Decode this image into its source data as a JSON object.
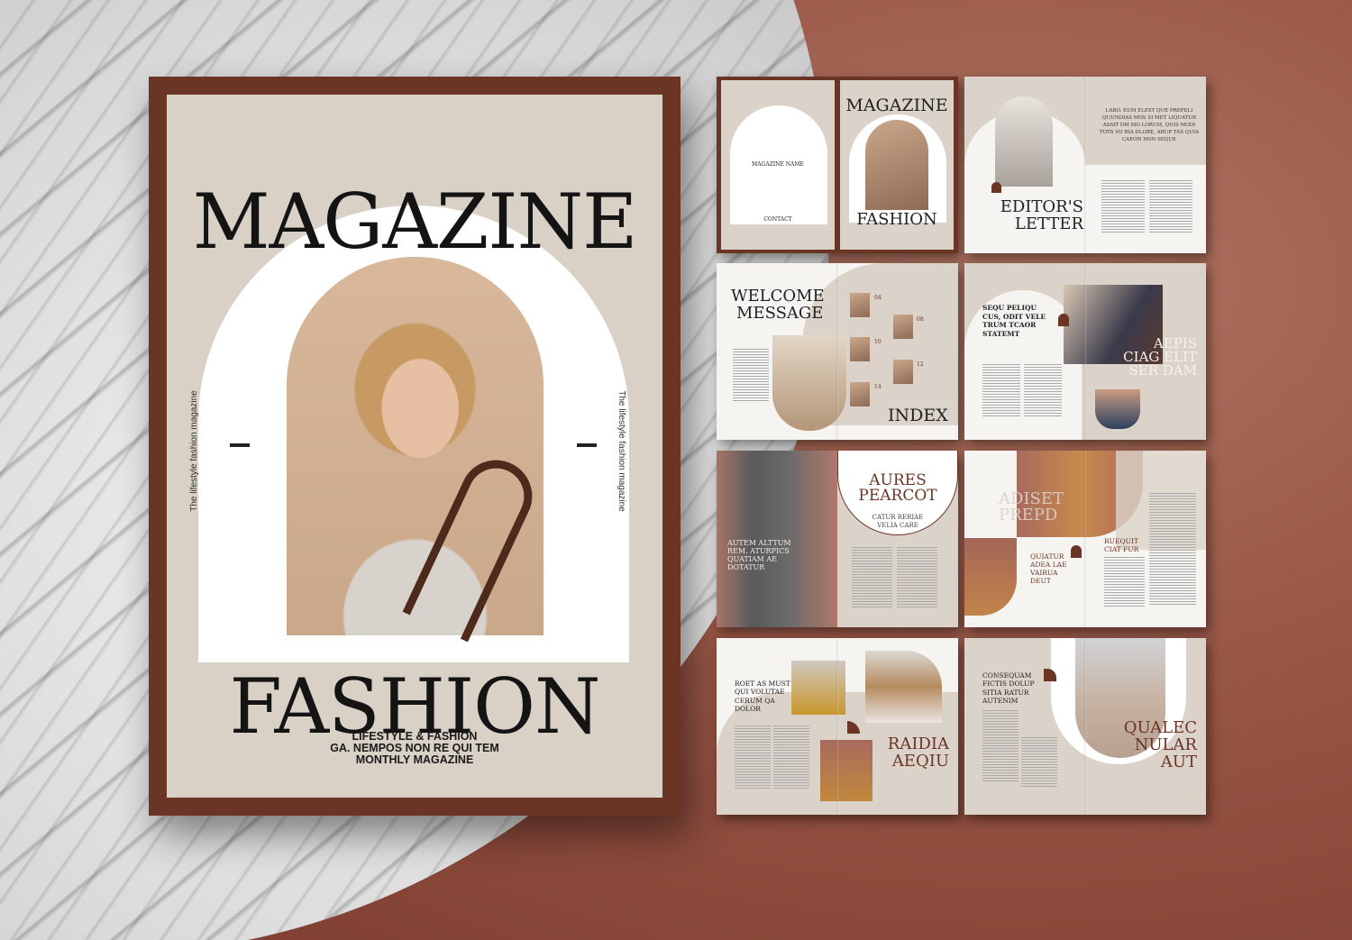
{
  "cover": {
    "title_top": "MAGAZINE",
    "title_bottom": "FASHION",
    "side_text": "The lifestyle fashion magazine",
    "subtitle": [
      "LIFESTYLE & FASHION",
      "GA. NEMPOS NON RE QUI TEM",
      "MONTHLY MAGAZINE"
    ]
  },
  "spreads": {
    "s1": {
      "back_title": "MAGAZINE NAME",
      "back_contact": "CONTACT",
      "front_top": "MAGAZINE",
      "front_bottom": "FASHION"
    },
    "s2": {
      "quote": "LABO. EUM ELEST QUE PREPELI QUUNDIAS MOS SI MET LIQUATUR ASSIT OM MO LORUM, QUIS MODI TOTA VO RIA DLORE, ARUP TAS QUIA CAEON NON SEQUE",
      "title": [
        "EDITOR'S",
        "LETTER"
      ]
    },
    "s3": {
      "title": [
        "WELCOME",
        "MESSAGE"
      ],
      "index_title": "INDEX",
      "index_numbers": [
        "04",
        "08",
        "10",
        "12",
        "14"
      ]
    },
    "s4": {
      "heading": [
        "SEQU PELIQU",
        "CUS, ODIT VELE",
        "TRUM TCAOR",
        "STATEMT"
      ],
      "overlay": [
        "AEPIS",
        "CIAG ELIT",
        "SER DAM"
      ]
    },
    "s5": {
      "overlay": [
        "AUTEM ALTTUM",
        "REM. ATURPICS",
        "QUATIAM AE",
        "DOTATUR"
      ],
      "title": [
        "AURES",
        "PEARCOT"
      ],
      "subtitle": [
        "CATUR RERIAE",
        "VELIA CARE"
      ]
    },
    "s6": {
      "title": [
        "ADISET",
        "PREPD"
      ],
      "heading": [
        "QUIATUR",
        "ADEA LAE",
        "VAIRUA",
        "DEUT"
      ],
      "side": [
        "RUEQUIT",
        "CIAT FUR"
      ]
    },
    "s7": {
      "heading": [
        "ROET AS MUST",
        "QUI VOLUTAE",
        "CERUM QA",
        "DOLOR"
      ],
      "title": [
        "RAIDIA",
        "AEQIU"
      ]
    },
    "s8": {
      "heading": [
        "CONSEQUAM",
        "FICTIS DOLUP",
        "SITIA RATUR",
        "AUTENIM"
      ],
      "title": [
        "QUALEC",
        "NULAR",
        "AUT"
      ]
    }
  },
  "colors": {
    "brand": "#6b3526",
    "beige": "#d9d1c6"
  }
}
